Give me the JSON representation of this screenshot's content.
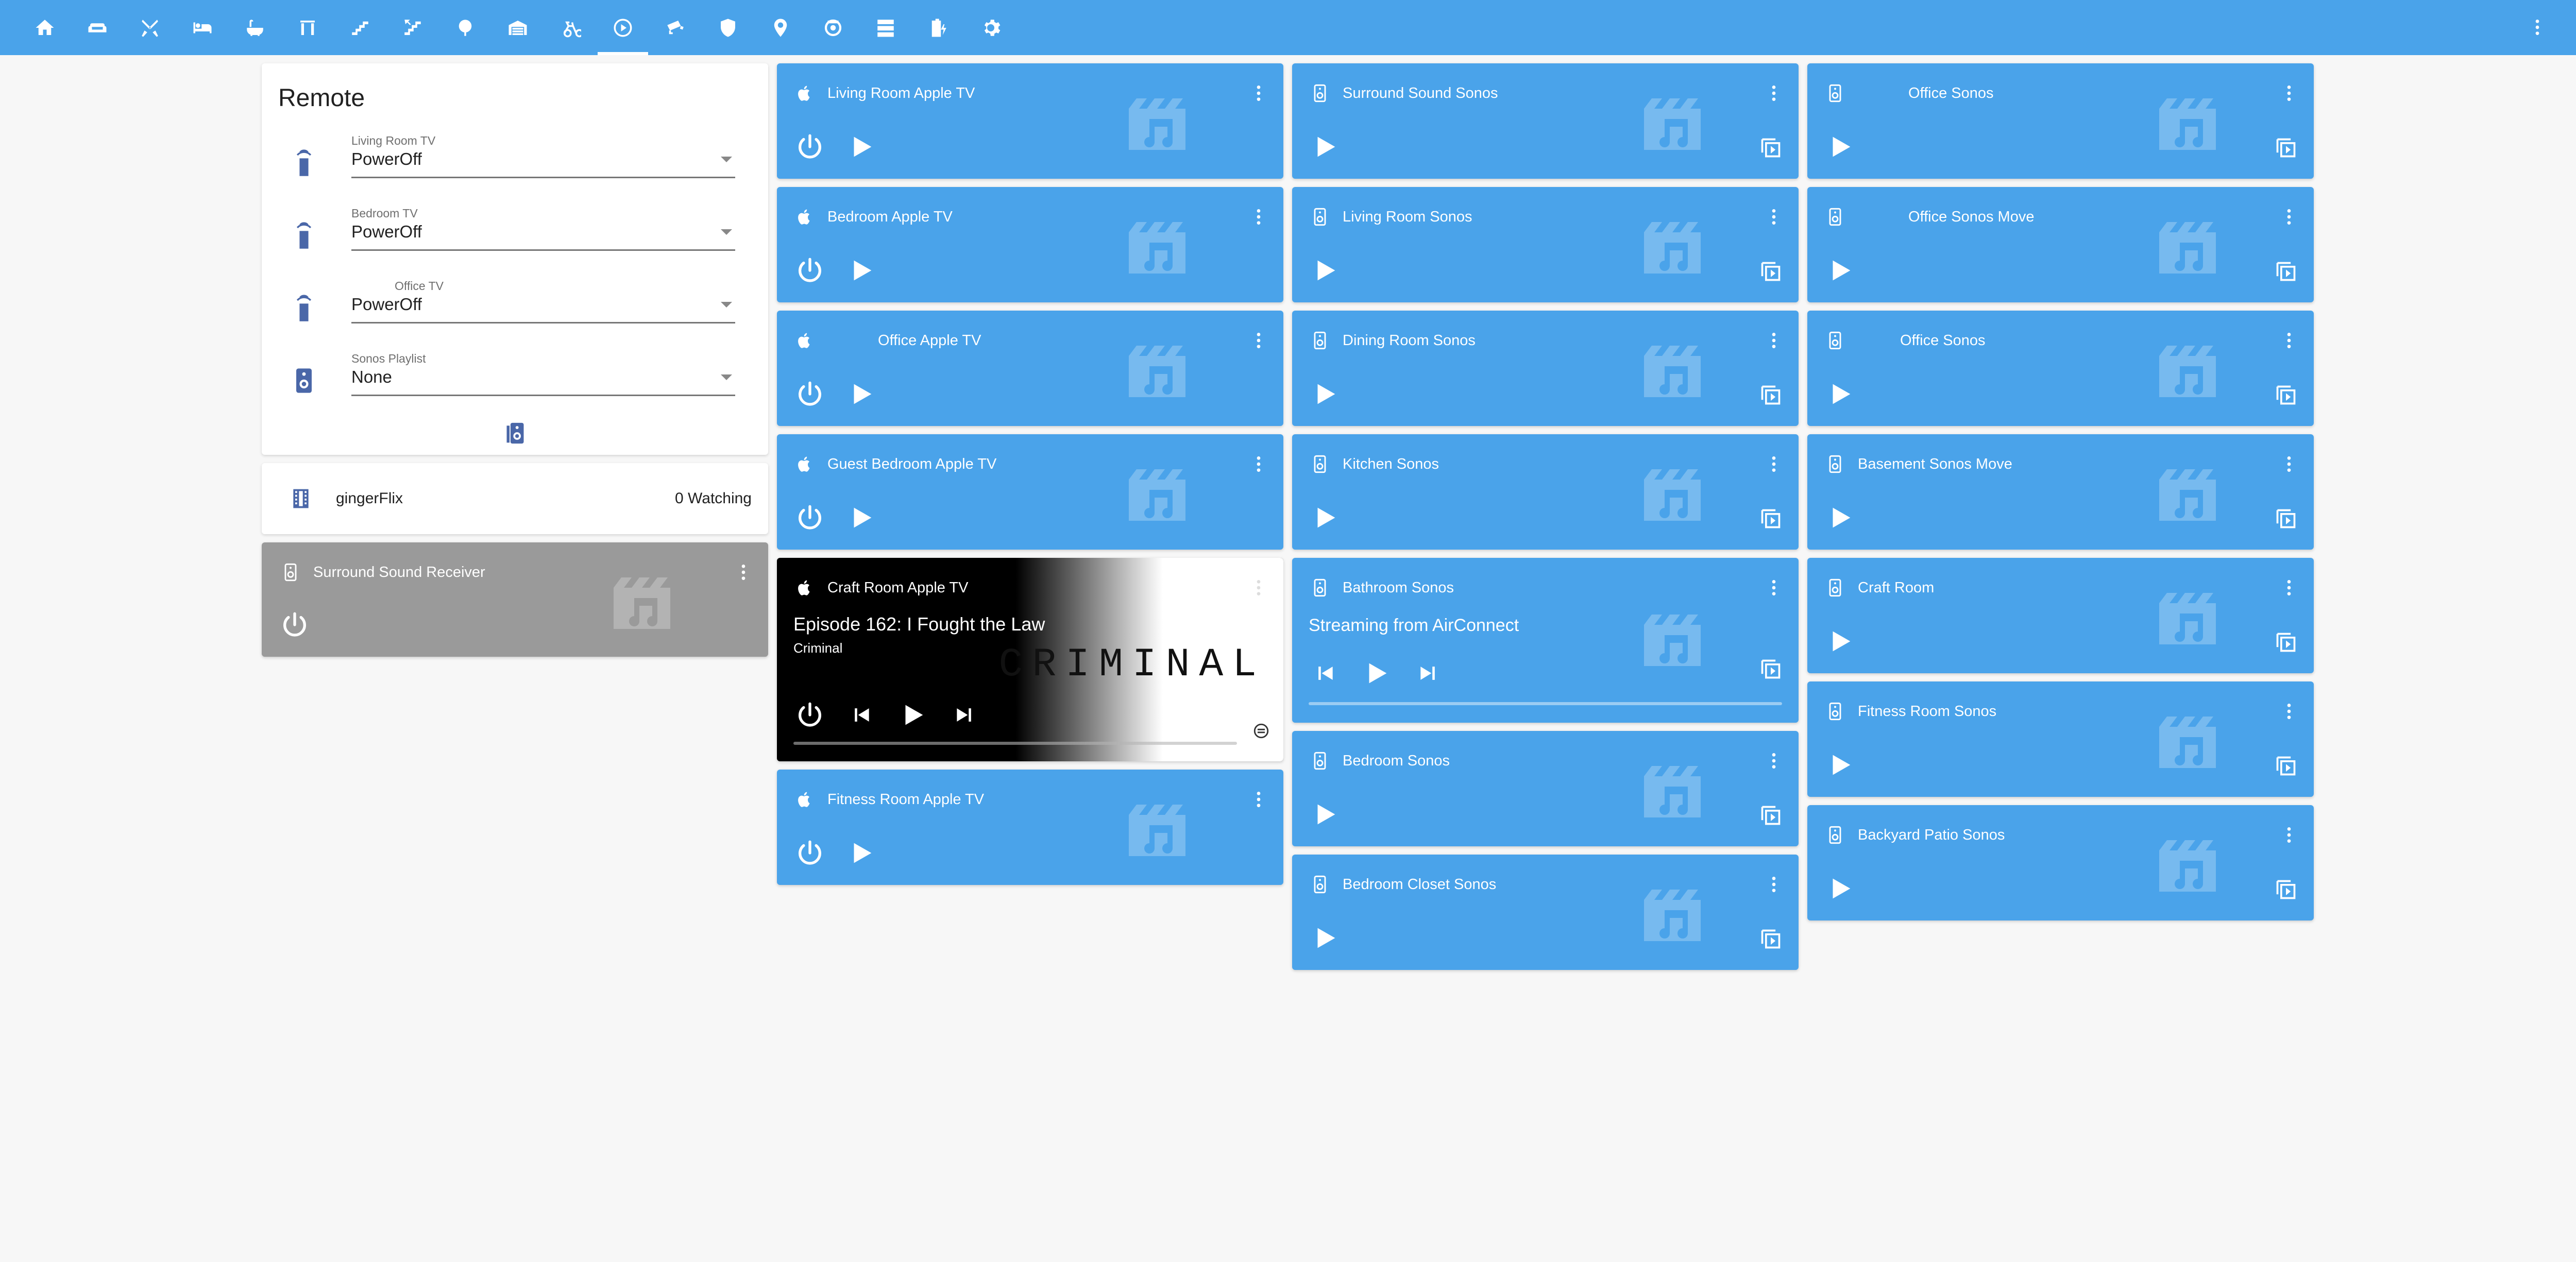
{
  "colors": {
    "primary": "#4aa3ea",
    "background": "#f7f7f7",
    "grey_card": "#9a9a9a"
  },
  "nav": {
    "tabs": [
      {
        "icon": "home-icon",
        "active": false
      },
      {
        "icon": "sofa-icon",
        "active": false
      },
      {
        "icon": "utensils-icon",
        "active": false
      },
      {
        "icon": "bed-icon",
        "active": false
      },
      {
        "icon": "bathtub-icon",
        "active": false
      },
      {
        "icon": "wardrobe-icon",
        "active": false
      },
      {
        "icon": "stairs-icon",
        "active": false
      },
      {
        "icon": "stairs-up-icon",
        "active": false
      },
      {
        "icon": "tree-icon",
        "active": false
      },
      {
        "icon": "garage-icon",
        "active": false
      },
      {
        "icon": "bicycle-icon",
        "active": false
      },
      {
        "icon": "play-circle-icon",
        "active": true
      },
      {
        "icon": "cctv-icon",
        "active": false
      },
      {
        "icon": "shield-icon",
        "active": false
      },
      {
        "icon": "map-marker-icon",
        "active": false
      },
      {
        "icon": "robot-vacuum-icon",
        "active": false
      },
      {
        "icon": "server-icon",
        "active": false
      },
      {
        "icon": "battery-charging-icon",
        "active": false
      },
      {
        "icon": "gear-icon",
        "active": false
      }
    ]
  },
  "remote": {
    "title": "Remote",
    "selects": [
      {
        "label": "Living Room TV",
        "value": "PowerOff",
        "icon": "remote-icon"
      },
      {
        "label": "Bedroom TV",
        "value": "PowerOff",
        "icon": "remote-icon"
      },
      {
        "label": "Office TV",
        "value": "PowerOff",
        "icon": "remote-icon"
      },
      {
        "label": "Sonos Playlist",
        "value": "None",
        "icon": "speaker-icon"
      }
    ]
  },
  "flix": {
    "name": "gingerFlix",
    "count": "0 Watching"
  },
  "receiver": {
    "name": "Surround Sound Receiver"
  },
  "col2": [
    {
      "name": "Living Room Apple TV"
    },
    {
      "name": "Bedroom Apple TV"
    },
    {
      "name": "Office Apple TV"
    },
    {
      "name": "Guest Bedroom Apple TV"
    },
    {
      "name": "Craft Room Apple TV",
      "title": "Episode 162: I Fought the Law",
      "subtitle": "Criminal",
      "art": "CRIMINAL"
    },
    {
      "name": "Fitness Room Apple TV"
    }
  ],
  "col3": [
    {
      "name": "Surround Sound Sonos"
    },
    {
      "name": "Living Room Sonos"
    },
    {
      "name": "Dining Room Sonos"
    },
    {
      "name": "Kitchen Sonos"
    },
    {
      "name": "Bathroom Sonos",
      "title": "Streaming from AirConnect"
    },
    {
      "name": "Bedroom Sonos"
    },
    {
      "name": "Bedroom Closet Sonos"
    }
  ],
  "col4": [
    {
      "name": "Office Sonos"
    },
    {
      "name": "Office Sonos Move"
    },
    {
      "name": "Office Sonos"
    },
    {
      "name": "Basement Sonos Move"
    },
    {
      "name": "Craft Room"
    },
    {
      "name": "Fitness Room Sonos"
    },
    {
      "name": "Backyard Patio Sonos"
    }
  ]
}
